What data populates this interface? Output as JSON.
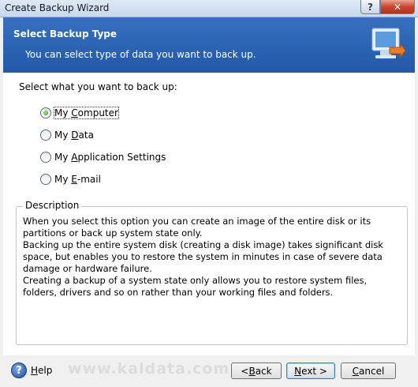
{
  "window": {
    "title": "Create Backup Wizard",
    "help_glyph": "?",
    "close_glyph": "✕"
  },
  "header": {
    "title": "Select Backup Type",
    "subtitle": "You can select type of data you want to back up.",
    "icon": "computer-backup-icon"
  },
  "main": {
    "prompt": "Select what you want to back up:",
    "options": [
      {
        "pre": "My ",
        "key": "C",
        "post": "omputer",
        "selected": true
      },
      {
        "pre": "My ",
        "key": "D",
        "post": "ata",
        "selected": false
      },
      {
        "pre": "My ",
        "key": "A",
        "post": "pplication Settings",
        "selected": false
      },
      {
        "pre": "My ",
        "key": "E",
        "post": "-mail",
        "selected": false
      }
    ]
  },
  "description": {
    "legend": "Description",
    "paragraphs": [
      "When you select this option you can create an image of the entire disk or its partitions or back up system state only.",
      "Backing up the entire system disk (creating a disk image) takes significant disk space, but enables you to restore the system in minutes in case of severe data damage or hardware failure.",
      "Creating a backup of a system state only allows you to restore system files, folders, drivers and so on rather than your working files and folders."
    ]
  },
  "footer": {
    "help_label": "Help",
    "help_key": "H",
    "help_rest": "elp",
    "watermark": "www.kaldata.com",
    "back": {
      "pre": "< ",
      "key": "B",
      "post": "ack"
    },
    "next": {
      "pre": "",
      "key": "N",
      "post": "ext >"
    },
    "cancel": {
      "pre": "",
      "key": "C",
      "post": "ancel"
    }
  },
  "colors": {
    "header_bg": "#2a63b3",
    "accent_green": "#2e9b14"
  }
}
